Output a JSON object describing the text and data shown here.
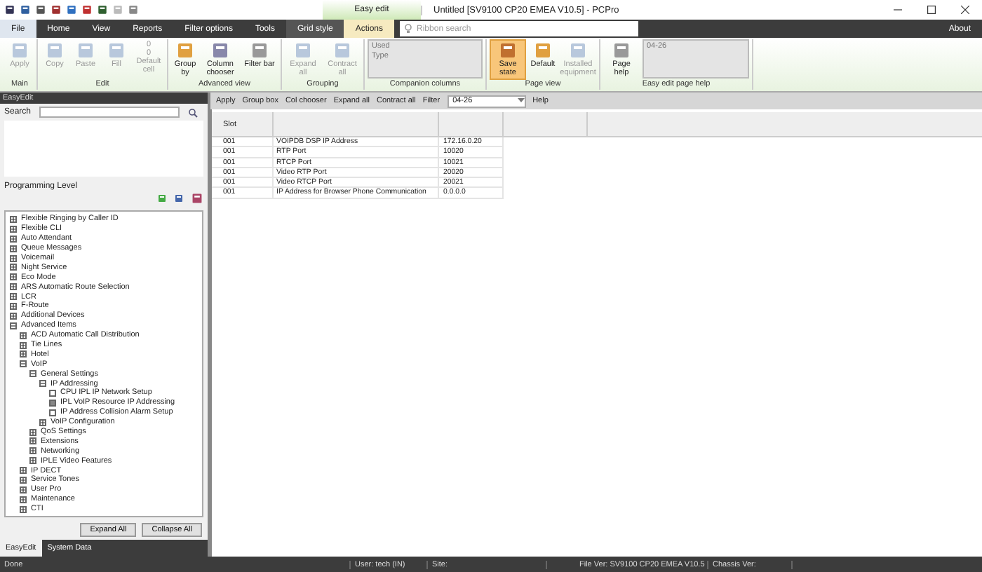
{
  "window": {
    "title": "Untitled [SV9100 CP20 EMEA V10.5] - PCPro",
    "context_tab": "Easy edit"
  },
  "ribbon_tabs": [
    {
      "label": "File",
      "selected": false
    },
    {
      "label": "Home",
      "selected": false
    },
    {
      "label": "View",
      "selected": false
    },
    {
      "label": "Reports",
      "selected": false
    },
    {
      "label": "Filter options",
      "selected": false
    },
    {
      "label": "Tools",
      "selected": false
    },
    {
      "label": "Grid style",
      "selected": false
    },
    {
      "label": "Actions",
      "selected": true
    }
  ],
  "ribbon_search": {
    "placeholder": "Ribbon search"
  },
  "about": "About",
  "ribbon_groups": [
    {
      "label": "Main",
      "items": [
        {
          "kind": "button",
          "label": "Apply",
          "disabled": true,
          "selected": false
        }
      ]
    },
    {
      "label": "Edit",
      "items": [
        {
          "kind": "button",
          "label": "Copy",
          "disabled": true,
          "selected": false
        },
        {
          "kind": "button",
          "label": "Paste",
          "disabled": true,
          "selected": false
        },
        {
          "kind": "button",
          "label": "Fill",
          "disabled": true,
          "selected": false
        },
        {
          "kind": "counter",
          "label": "Default cell",
          "values": [
            "0",
            "0"
          ],
          "disabled": true
        }
      ]
    },
    {
      "label": "Advanced view",
      "items": [
        {
          "kind": "button",
          "label": "Group by",
          "disabled": false,
          "selected": false
        },
        {
          "kind": "button",
          "label": "Column chooser",
          "disabled": false,
          "selected": false
        },
        {
          "kind": "button",
          "label": "Filter bar",
          "disabled": false,
          "selected": false
        }
      ]
    },
    {
      "label": "Grouping",
      "items": [
        {
          "kind": "button",
          "label": "Expand all",
          "disabled": true,
          "selected": false
        },
        {
          "kind": "button",
          "label": "Contract all",
          "disabled": true,
          "selected": false
        }
      ]
    },
    {
      "label": "Companion columns",
      "items": [
        {
          "kind": "list",
          "entries": [
            "Used",
            "Type"
          ]
        }
      ]
    },
    {
      "label": "Page view",
      "items": [
        {
          "kind": "button",
          "label": "Save state",
          "disabled": false,
          "selected": true
        },
        {
          "kind": "button",
          "label": "Default",
          "disabled": false,
          "selected": false
        },
        {
          "kind": "button",
          "label": "Installed equipment",
          "disabled": true,
          "selected": false
        }
      ]
    },
    {
      "label": "Easy edit page help",
      "items": [
        {
          "kind": "button",
          "label": "Page help",
          "disabled": false,
          "selected": false
        },
        {
          "kind": "list",
          "entries": [
            "04-26"
          ]
        }
      ]
    }
  ],
  "left_panel": {
    "title": "EasyEdit",
    "search_label": "Search",
    "programming_level_label": "Programming Level",
    "tree": [
      {
        "label": "Flexible Ringing by Caller ID",
        "expanded": false
      },
      {
        "label": "Flexible CLI",
        "expanded": false
      },
      {
        "label": "Auto Attendant",
        "expanded": false
      },
      {
        "label": "Queue Messages",
        "expanded": false
      },
      {
        "label": "Voicemail",
        "expanded": false
      },
      {
        "label": "Night Service",
        "expanded": false
      },
      {
        "label": "Eco Mode",
        "expanded": false
      },
      {
        "label": "ARS  Automatic Route Selection",
        "expanded": false
      },
      {
        "label": "LCR",
        "expanded": false
      },
      {
        "label": "F-Route",
        "expanded": false
      },
      {
        "label": "Additional Devices",
        "expanded": false
      },
      {
        "label": "Advanced Items",
        "expanded": true,
        "children": [
          {
            "label": "ACD Automatic Call Distribution",
            "expanded": false
          },
          {
            "label": "Tie Lines",
            "expanded": false
          },
          {
            "label": "Hotel",
            "expanded": false
          },
          {
            "label": "VoIP",
            "expanded": true,
            "children": [
              {
                "label": "General Settings",
                "expanded": true,
                "children": [
                  {
                    "label": "IP Addressing",
                    "expanded": true,
                    "children": [
                      {
                        "label": "CPU IPL IP Network Setup",
                        "selected": false
                      },
                      {
                        "label": "IPL VoIP Resource IP Addressing",
                        "selected": true
                      },
                      {
                        "label": "IP Address Collision Alarm Setup",
                        "selected": false
                      }
                    ]
                  },
                  {
                    "label": "VoIP Configuration",
                    "expanded": false
                  }
                ]
              },
              {
                "label": "QoS Settings",
                "expanded": false
              },
              {
                "label": "Extensions",
                "expanded": false
              },
              {
                "label": "Networking",
                "expanded": false
              },
              {
                "label": "IPLE Video Features",
                "expanded": false
              }
            ]
          },
          {
            "label": "IP DECT",
            "expanded": false
          },
          {
            "label": "Service Tones",
            "expanded": false
          },
          {
            "label": "User Pro",
            "expanded": false
          },
          {
            "label": "Maintenance",
            "expanded": false
          },
          {
            "label": "CTI",
            "expanded": false
          }
        ]
      }
    ],
    "buttons": [
      "Expand All",
      "Collapse All"
    ]
  },
  "panel_tabs": [
    {
      "label": "EasyEdit",
      "selected": true
    },
    {
      "label": "System Data",
      "selected": false
    }
  ],
  "toolbar": {
    "buttons": [
      "Apply",
      "Group box",
      "Col chooser",
      "Expand all",
      "Contract all",
      "Filter"
    ],
    "page_select": "04-26",
    "help": "Help"
  },
  "table": {
    "columns": [
      "Slot"
    ],
    "rows": [
      [
        "001",
        "VOIPDB DSP IP Address",
        "172.16.0.20"
      ],
      [
        "001",
        "RTP Port",
        "10020"
      ],
      [
        "001",
        "RTCP Port",
        "10021"
      ],
      [
        "001",
        "Video RTP Port",
        "20020"
      ],
      [
        "001",
        "Video RTCP Port",
        "20021"
      ],
      [
        "001",
        "IP Address for Browser Phone Communication",
        "0.0.0.0"
      ]
    ]
  },
  "status_bar": [
    "Done",
    "User: tech (IN)",
    "Site:",
    "File Ver: SV9100 CP20 EMEA V10.5",
    "Chassis Ver:"
  ]
}
